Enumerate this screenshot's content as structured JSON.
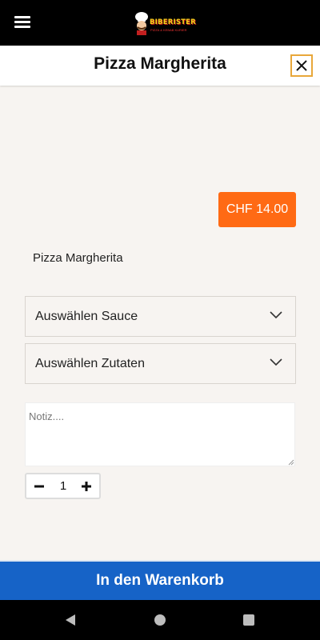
{
  "app": {
    "brand_name": "BIBERISTER",
    "brand_tagline": "PIZZA & KEBAB KURIER"
  },
  "header": {
    "title": "Pizza Margherita"
  },
  "product": {
    "price": "CHF 14.00",
    "description": "Pizza Margherita"
  },
  "options": {
    "sauce_label": "Auswählen Sauce",
    "zutaten_label": "Auswählen Zutaten"
  },
  "note": {
    "placeholder": "Notiz....",
    "value": ""
  },
  "quantity": {
    "value": "1"
  },
  "cart": {
    "button_label": "In den Warenkorb"
  },
  "colors": {
    "price_badge": "#ff6a14",
    "cart_button": "#1663c7",
    "close_border": "#e8a73a"
  },
  "icons": {
    "menu": "hamburger-icon",
    "close": "close-icon",
    "dropdown": "chevron-down-icon",
    "minus": "minus-icon",
    "plus": "plus-icon",
    "nav_back": "back-triangle-icon",
    "nav_home": "home-circle-icon",
    "nav_recent": "recent-square-icon"
  }
}
